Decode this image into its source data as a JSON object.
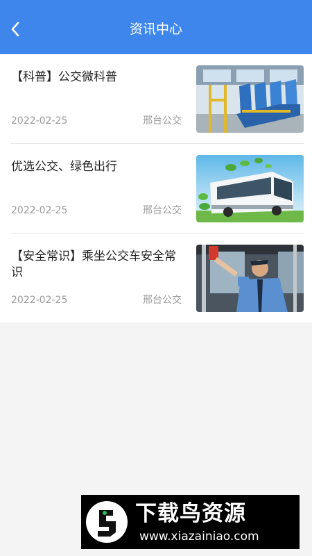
{
  "header": {
    "title": "资讯中心",
    "back_icon": "chevron-left-icon",
    "background": "#3f86ec"
  },
  "news": [
    {
      "title": "【科普】公交微科普",
      "date": "2022-02-25",
      "source": "邢台公交",
      "thumb": "bus-seats-photo"
    },
    {
      "title": "优选公交、绿色出行",
      "date": "2022-02-25",
      "source": "邢台公交",
      "thumb": "green-bus-photo"
    },
    {
      "title": "【安全常识】乘坐公交车安全常识",
      "date": "2022-02-25",
      "source": "邢台公交",
      "thumb": "bus-officer-photo"
    }
  ],
  "watermark": {
    "brand": "下载鸟资源",
    "url": "www.xiazainiao.com"
  }
}
